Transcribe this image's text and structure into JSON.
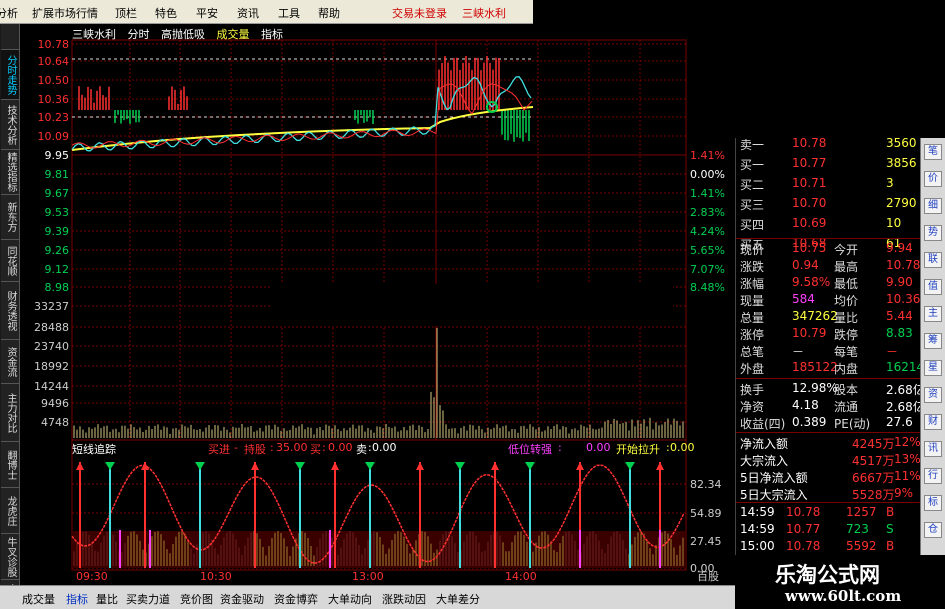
{
  "menu": [
    "分析",
    "扩展市场行情",
    "顶栏",
    "特色",
    "平安",
    "资讯",
    "工具",
    "帮助"
  ],
  "status_login": "交易未登录",
  "header_stock": "三峡水利",
  "chart_header": [
    "三峡水利",
    "分时",
    "高抛低吸",
    "成交量",
    "指标"
  ],
  "left_tabs": [
    "分时走势",
    "技术分析",
    "精选指标",
    "新东方",
    "同花顺",
    "财务透视",
    "资金流",
    "主力对比",
    "翻博士",
    "龙虎庄",
    "牛叉诊股",
    "魔法"
  ],
  "price_axis": [
    "10.78",
    "10.64",
    "10.50",
    "10.36",
    "10.23",
    "10.09",
    "9.95",
    "9.81",
    "9.67",
    "9.53",
    "9.39",
    "9.26",
    "9.12",
    "8.98"
  ],
  "pct_axis": [
    "1.41%",
    "0.00%",
    "1.41%",
    "2.83%",
    "4.24%",
    "5.65%",
    "7.07%",
    "8.48%"
  ],
  "volume_axis": [
    "33237",
    "28488",
    "23740",
    "18992",
    "14244",
    "9496",
    "4748"
  ],
  "indicator_header": {
    "name": "短线追踪",
    "buy": "买进",
    "hold": "持股",
    "hold_val": "35.00",
    "buy2": "买",
    "buy2_val": "0.00",
    "sell": "卖",
    "sell_val": "0.00",
    "low_turn": "低位转强",
    "low_turn_val": "0.00",
    "start_pull": "开始拉升",
    "start_pull_val": "0.00"
  },
  "indicator_axis": [
    "82.34",
    "54.89",
    "27.45",
    "0.00"
  ],
  "time_axis": [
    "09:30",
    "10:30",
    "13:00",
    "14:00"
  ],
  "time_unit": "百股",
  "bottom_tabs": [
    "成交量",
    "指标",
    "量比",
    "买卖力道",
    "竞价图",
    "资金驱动",
    "资金博弈",
    "大单动向",
    "涨跌动因",
    "大单差分"
  ],
  "orderbook": [
    {
      "label": "卖一",
      "price": "10.78",
      "vol": "3560"
    },
    {
      "label": "买一",
      "price": "10.77",
      "vol": "3856"
    },
    {
      "label": "买二",
      "price": "10.71",
      "vol": "3"
    },
    {
      "label": "买三",
      "price": "10.70",
      "vol": "2790"
    },
    {
      "label": "买四",
      "price": "10.69",
      "vol": "10"
    },
    {
      "label": "买五",
      "price": "10.68",
      "vol": "61"
    }
  ],
  "stats": [
    {
      "l1": "现价",
      "v1": "10.75",
      "l2": "今开",
      "v2": "9.94"
    },
    {
      "l1": "涨跌",
      "v1": "0.94",
      "l2": "最高",
      "v2": "10.78"
    },
    {
      "l1": "涨幅",
      "v1": "9.58%",
      "l2": "最低",
      "v2": "9.90"
    },
    {
      "l1": "现量",
      "v1": "584",
      "l2": "均价",
      "v2": "10.36"
    },
    {
      "l1": "总量",
      "v1": "347262",
      "l2": "量比",
      "v2": "5.44"
    },
    {
      "l1": "涨停",
      "v1": "10.79",
      "l2": "跌停",
      "v2": "8.83"
    },
    {
      "l1": "总笔",
      "v1": "－",
      "l2": "每笔",
      "v2": "－"
    },
    {
      "l1": "外盘",
      "v1": "185122",
      "l2": "内盘",
      "v2": "162140"
    }
  ],
  "stats2": [
    {
      "l1": "换手",
      "v1": "12.98%",
      "l2": "股本",
      "v2": "2.68亿"
    },
    {
      "l1": "净资",
      "v1": "4.18",
      "l2": "流通",
      "v2": "2.68亿"
    },
    {
      "l1": "收益(四)",
      "v1": "0.389",
      "l2": "PE(动)",
      "v2": "27.6"
    }
  ],
  "flows": [
    {
      "label": "净流入额",
      "val": "4245万",
      "pct": "12%"
    },
    {
      "label": "大宗流入",
      "val": "4517万",
      "pct": "13%"
    },
    {
      "label": "5日净流入额",
      "val": "6667万",
      "pct": "11%"
    },
    {
      "label": "5日大宗流入",
      "val": "5528万",
      "pct": "9%"
    }
  ],
  "ticks": [
    {
      "time": "14:59",
      "price": "10.78",
      "vol": "1257",
      "side": "B"
    },
    {
      "time": "14:59",
      "price": "10.77",
      "vol": "723",
      "side": "S"
    },
    {
      "time": "15:00",
      "price": "10.78",
      "vol": "5592",
      "side": "B"
    }
  ],
  "side_buttons": [
    "笔",
    "价",
    "细",
    "势",
    "联",
    "值",
    "主",
    "筹",
    "星",
    "资",
    "财",
    "讯",
    "行",
    "标",
    "仓"
  ],
  "bottom_right_tab": "笔",
  "watermark": {
    "line1": "乐淘公式网",
    "line2": "www.60lt.com"
  },
  "colors": {
    "up": "#ff3030",
    "down": "#00d050",
    "yellow": "#ffff40",
    "cyan": "#40e0e0",
    "magenta": "#ff40ff",
    "grid": "#7a0000"
  }
}
